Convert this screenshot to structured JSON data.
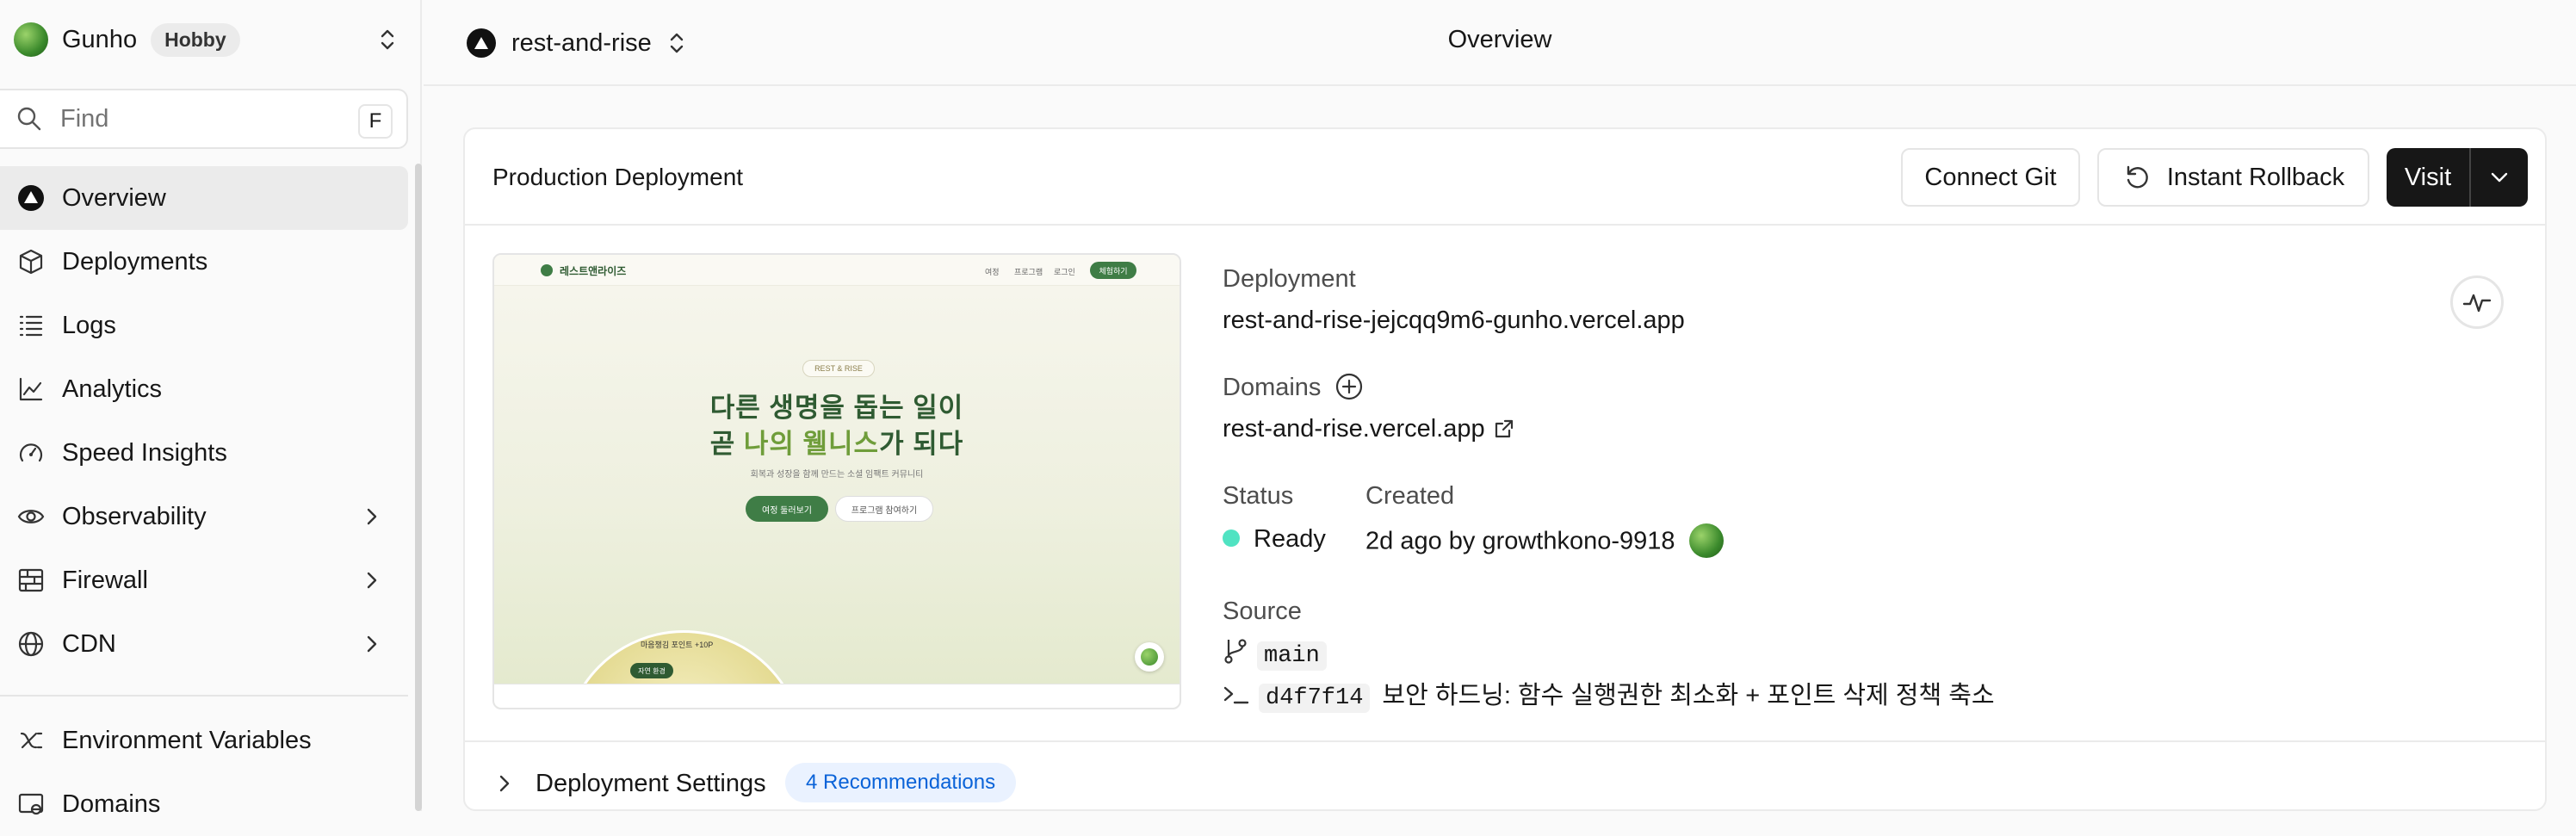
{
  "team": {
    "name": "Gunho",
    "plan": "Hobby"
  },
  "search": {
    "placeholder": "Find",
    "shortcut": "F"
  },
  "sidebar": {
    "items": [
      {
        "label": "Overview"
      },
      {
        "label": "Deployments"
      },
      {
        "label": "Logs"
      },
      {
        "label": "Analytics"
      },
      {
        "label": "Speed Insights"
      },
      {
        "label": "Observability"
      },
      {
        "label": "Firewall"
      },
      {
        "label": "CDN"
      },
      {
        "label": "Environment Variables"
      },
      {
        "label": "Domains"
      }
    ]
  },
  "header": {
    "project": "rest-and-rise",
    "page_title": "Overview"
  },
  "card": {
    "title": "Production Deployment",
    "buttons": {
      "connect_git": "Connect Git",
      "rollback": "Instant Rollback",
      "visit": "Visit"
    }
  },
  "preview": {
    "brand": "레스트앤라이즈",
    "nav_links": [
      "여정",
      "프로그램",
      "로그인"
    ],
    "nav_cta": "체험하기",
    "tag": "REST & RISE",
    "headline_1": "다른 생명을 돕는 일이",
    "headline_2_pre": "곧 ",
    "headline_2_hl": "나의 웰니스",
    "headline_2_post": "가 되다",
    "subtitle": "회복과 성장을 함께 만드는 소셜 임팩트 커뮤니티",
    "btn_primary": "여정 둘러보기",
    "btn_secondary": "프로그램 참여하기",
    "circle_label": "마음챙김 포인트 +10P",
    "circle_pill": "자연 환경"
  },
  "deployment": {
    "label": "Deployment",
    "url": "rest-and-rise-jejcqq9m6-gunho.vercel.app",
    "domains_label": "Domains",
    "domain": "rest-and-rise.vercel.app",
    "status_label": "Status",
    "status": "Ready",
    "created_label": "Created",
    "created": "2d ago by growthkono-9918",
    "source_label": "Source",
    "branch": "main",
    "commit_hash": "d4f7f14",
    "commit_message": "보안 하드닝: 함수 실행권한 최소화 + 포인트 삭제 정책 축소"
  },
  "settings": {
    "title": "Deployment Settings",
    "badge": "4 Recommendations"
  },
  "colors": {
    "ready": "#50e3c2",
    "badge_text": "#0a63d8",
    "badge_bg": "#eaf2ff",
    "visit_bg": "#171717"
  }
}
